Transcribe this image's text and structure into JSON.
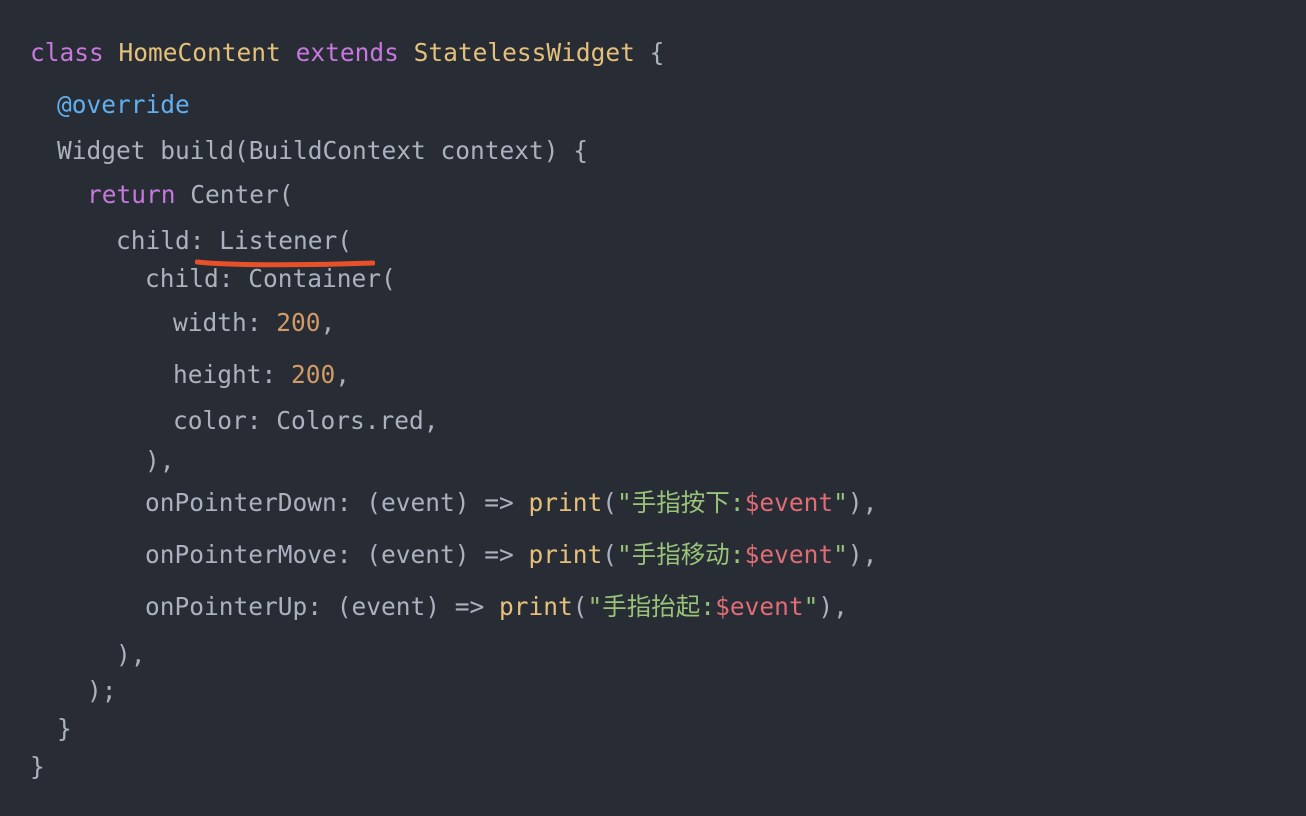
{
  "colors": {
    "background": "#282c34",
    "keyword": "#c678dd",
    "class_name": "#e5c07b",
    "annotation": "#61afef",
    "number": "#d19a66",
    "string": "#98c379",
    "interpolation": "#e06c75",
    "plain": "#abb2bf",
    "underline": "#e8502a"
  },
  "code": {
    "lines": [
      [
        {
          "text": "class",
          "type": "kw"
        },
        {
          "text": " ",
          "type": "plain"
        },
        {
          "text": "HomeContent",
          "type": "cls"
        },
        {
          "text": " ",
          "type": "plain"
        },
        {
          "text": "extends",
          "type": "kw"
        },
        {
          "text": " ",
          "type": "plain"
        },
        {
          "text": "StatelessWidget",
          "type": "cls"
        },
        {
          "text": " {",
          "type": "plain"
        }
      ],
      [
        {
          "text": "@override",
          "type": "ann"
        }
      ],
      [
        {
          "text": "Widget build(BuildContext context) {",
          "type": "plain"
        }
      ],
      [
        {
          "text": "return",
          "type": "kw"
        },
        {
          "text": " Center(",
          "type": "plain"
        }
      ],
      [
        {
          "text": "child: Listener(",
          "type": "plain"
        }
      ],
      [
        {
          "text": "child: Container(",
          "type": "plain"
        }
      ],
      [
        {
          "text": "width: ",
          "type": "plain"
        },
        {
          "text": "200",
          "type": "num"
        },
        {
          "text": ",",
          "type": "plain"
        }
      ],
      [
        {
          "text": "height: ",
          "type": "plain"
        },
        {
          "text": "200",
          "type": "num"
        },
        {
          "text": ",",
          "type": "plain"
        }
      ],
      [
        {
          "text": "color: Colors.red,",
          "type": "plain"
        }
      ],
      [
        {
          "text": "),",
          "type": "plain"
        }
      ],
      [
        {
          "text": "onPointerDown: (event) => ",
          "type": "plain"
        },
        {
          "text": "print",
          "type": "fn"
        },
        {
          "text": "(",
          "type": "plain"
        },
        {
          "text": "\"手指按下:",
          "type": "str"
        },
        {
          "text": "$event",
          "type": "var"
        },
        {
          "text": "\"",
          "type": "str"
        },
        {
          "text": "),",
          "type": "plain"
        }
      ],
      [
        {
          "text": "onPointerMove: (event) => ",
          "type": "plain"
        },
        {
          "text": "print",
          "type": "fn"
        },
        {
          "text": "(",
          "type": "plain"
        },
        {
          "text": "\"手指移动:",
          "type": "str"
        },
        {
          "text": "$event",
          "type": "var"
        },
        {
          "text": "\"",
          "type": "str"
        },
        {
          "text": "),",
          "type": "plain"
        }
      ],
      [
        {
          "text": "onPointerUp: (event) => ",
          "type": "plain"
        },
        {
          "text": "print",
          "type": "fn"
        },
        {
          "text": "(",
          "type": "plain"
        },
        {
          "text": "\"手指抬起:",
          "type": "str"
        },
        {
          "text": "$event",
          "type": "var"
        },
        {
          "text": "\"",
          "type": "str"
        },
        {
          "text": "),",
          "type": "plain"
        }
      ],
      [
        {
          "text": "),",
          "type": "plain"
        }
      ],
      [
        {
          "text": ");",
          "type": "plain"
        }
      ],
      [
        {
          "text": "}",
          "type": "plain"
        }
      ],
      [
        {
          "text": "}",
          "type": "plain"
        }
      ]
    ]
  }
}
